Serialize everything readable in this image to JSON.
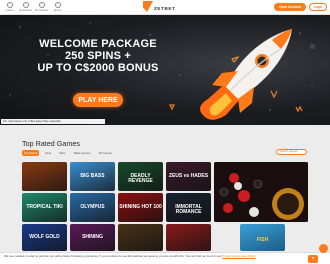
{
  "header": {
    "nav": [
      {
        "label": "Casino",
        "icon": "casino-icon"
      },
      {
        "label": "Sportsbook",
        "icon": "sportsbook-icon"
      },
      {
        "label": "Promotions",
        "icon": "promotions-icon"
      },
      {
        "label": "Sports",
        "icon": "sports-icon"
      }
    ],
    "logo_text": "ZETBET",
    "open_account": "Open Account",
    "login": "Login"
  },
  "hero": {
    "line1": "WELCOME PACKAGE",
    "line2": "250 SPINS +",
    "line3": "UP TO C$2000 BONUS",
    "cta": "PLAY HERE",
    "disclaimer": "18+ | New players only | T&Cs apply | Play responsibly"
  },
  "games": {
    "title": "Top Rated Games",
    "filters": [
      "Top Rated",
      "New",
      "Slots",
      "Table Games",
      "All Games"
    ],
    "search_placeholder": "Search games",
    "tiles": [
      {
        "title": "",
        "bg": "#8a3a12"
      },
      {
        "title": "BIG BASS",
        "bg": "#3a8fd0"
      },
      {
        "title": "DEADLY REVENGE",
        "bg": "#174a2a"
      },
      {
        "title": "ZEUS vs HADES",
        "bg": "#3a1a2a"
      },
      {
        "title": "TROPICAL TIKI",
        "bg": "#1e8a6a"
      },
      {
        "title": "OLYMPUS",
        "bg": "#2a6aa8"
      },
      {
        "title": "SHINING HOT 100",
        "bg": "#8a1010"
      },
      {
        "title": "IMMORTAL ROMANCE",
        "bg": "#1a2130"
      },
      {
        "title": "WOLF GOLD",
        "bg": "#1a3a8a"
      },
      {
        "title": "SHINING",
        "bg": "#5a1a5a"
      },
      {
        "title": "",
        "bg": "#4a3218"
      },
      {
        "title": "",
        "bg": "#8a1a1a"
      }
    ],
    "extra_tile": {
      "title": "FISH",
      "bg": "#3aa0d8"
    }
  },
  "cookie": {
    "text": "We use cookies in order to provide you with a better browsing experience. If you continue to use this website we assume you are ok with this. You can find out more in our",
    "link": "Privacy and Cookie Policy",
    "close": "×"
  },
  "colors": {
    "accent": "#ff7a1a",
    "hero_bg": "#1c1d21",
    "page_bg": "#ececec"
  }
}
